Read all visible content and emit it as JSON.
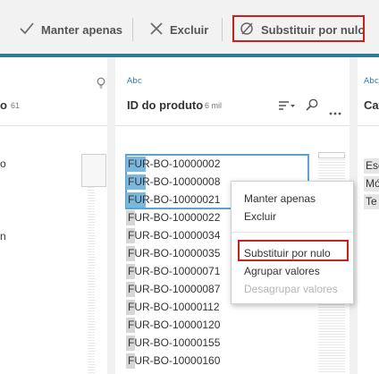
{
  "toolbar": {
    "keep_only_label": "Manter apenas",
    "exclude_label": "Excluir",
    "replace_null_label": "Substituir por nulo"
  },
  "columns": {
    "left": {
      "title": "o",
      "count": "61",
      "values": [
        "o",
        "n"
      ]
    },
    "middle": {
      "type_label": "Abc",
      "title": "ID do produto",
      "count": "6 mil",
      "values": [
        "FUR-BO-10000002",
        "FUR-BO-10000008",
        "FUR-BO-10000021",
        "FUR-BO-10000022",
        "FUR-BO-10000034",
        "FUR-BO-10000035",
        "FUR-BO-10000071",
        "FUR-BO-10000087",
        "FUR-BO-10000112",
        "FUR-BO-10000120",
        "FUR-BO-10000155",
        "FUR-BO-10000160"
      ]
    },
    "right": {
      "type_label": "Abc",
      "title": "Cat",
      "values": [
        "Esc",
        "Mó",
        "Te"
      ]
    }
  },
  "context_menu": {
    "keep_only": "Manter apenas",
    "exclude": "Excluir",
    "replace_null": "Substituir por nulo",
    "group_values": "Agrupar valores",
    "ungroup_values": "Desagrupar valores"
  },
  "colors": {
    "accent": "#2b7c9a",
    "highlight": "#cc1f1f",
    "selection": "#5aa5d0"
  }
}
